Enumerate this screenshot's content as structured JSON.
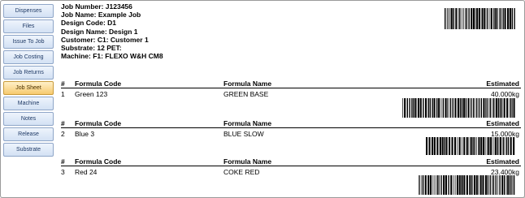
{
  "sidebar": {
    "items": [
      {
        "label": "Dispenses"
      },
      {
        "label": "Files"
      },
      {
        "label": "Issue To Job"
      },
      {
        "label": "Job Costing"
      },
      {
        "label": "Job Returns"
      },
      {
        "label": "Job Sheet",
        "active": true
      },
      {
        "label": "Machine"
      },
      {
        "label": "Notes"
      },
      {
        "label": "Release"
      },
      {
        "label": "Substrate"
      }
    ]
  },
  "job": {
    "job_number": "Job Number: J123456",
    "job_name": "Job Name: Example Job",
    "design_code": "Design Code: D1",
    "design_name": "Design Name: Design 1",
    "customer": "Customer: C1: Customer 1",
    "substrate": "Substrate: 12 PET:",
    "machine": "Machine: F1: FLEXO W&H CM8"
  },
  "columns": {
    "num": "#",
    "code": "Formula Code",
    "name": "Formula Name",
    "estimated": "Estimated"
  },
  "formulas": [
    {
      "num": "1",
      "code": "Green 123",
      "name": "GREEN BASE",
      "estimated": "40.000kg"
    },
    {
      "num": "2",
      "code": "Blue 3",
      "name": "BLUE SLOW",
      "estimated": "15.000kg"
    },
    {
      "num": "3",
      "code": "Red 24",
      "name": "COKE RED",
      "estimated": "23.400kg"
    }
  ],
  "colors": {
    "sidebar_button": "#d3e1f4",
    "sidebar_active": "#f6c96e"
  }
}
